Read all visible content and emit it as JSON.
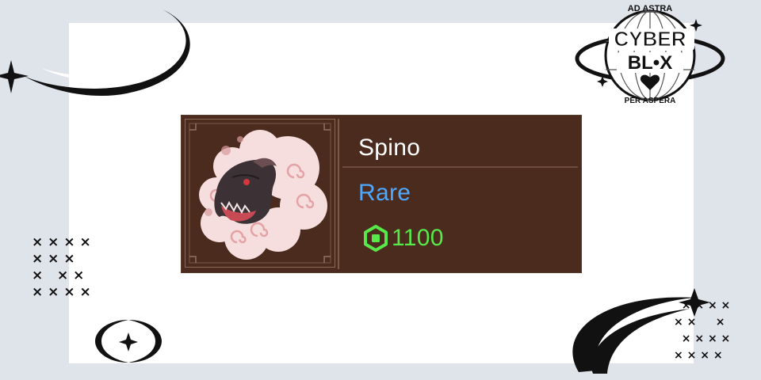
{
  "item": {
    "name": "Spino",
    "rarity": "Rare",
    "price": "1100",
    "rarity_color": "#4fa8ff",
    "price_color": "#58e84a",
    "currency_icon": "robux-icon",
    "portrait": "spino-dinosaur-head-portrait"
  },
  "logo": {
    "top_text": "AD ASTRA",
    "line1": "CYBER",
    "line2": "BL•X",
    "bottom_text": "PER ASPERA"
  },
  "colors": {
    "background": "#dfe3ea",
    "panel": "#ffffff",
    "card": "#4a2b1e"
  }
}
